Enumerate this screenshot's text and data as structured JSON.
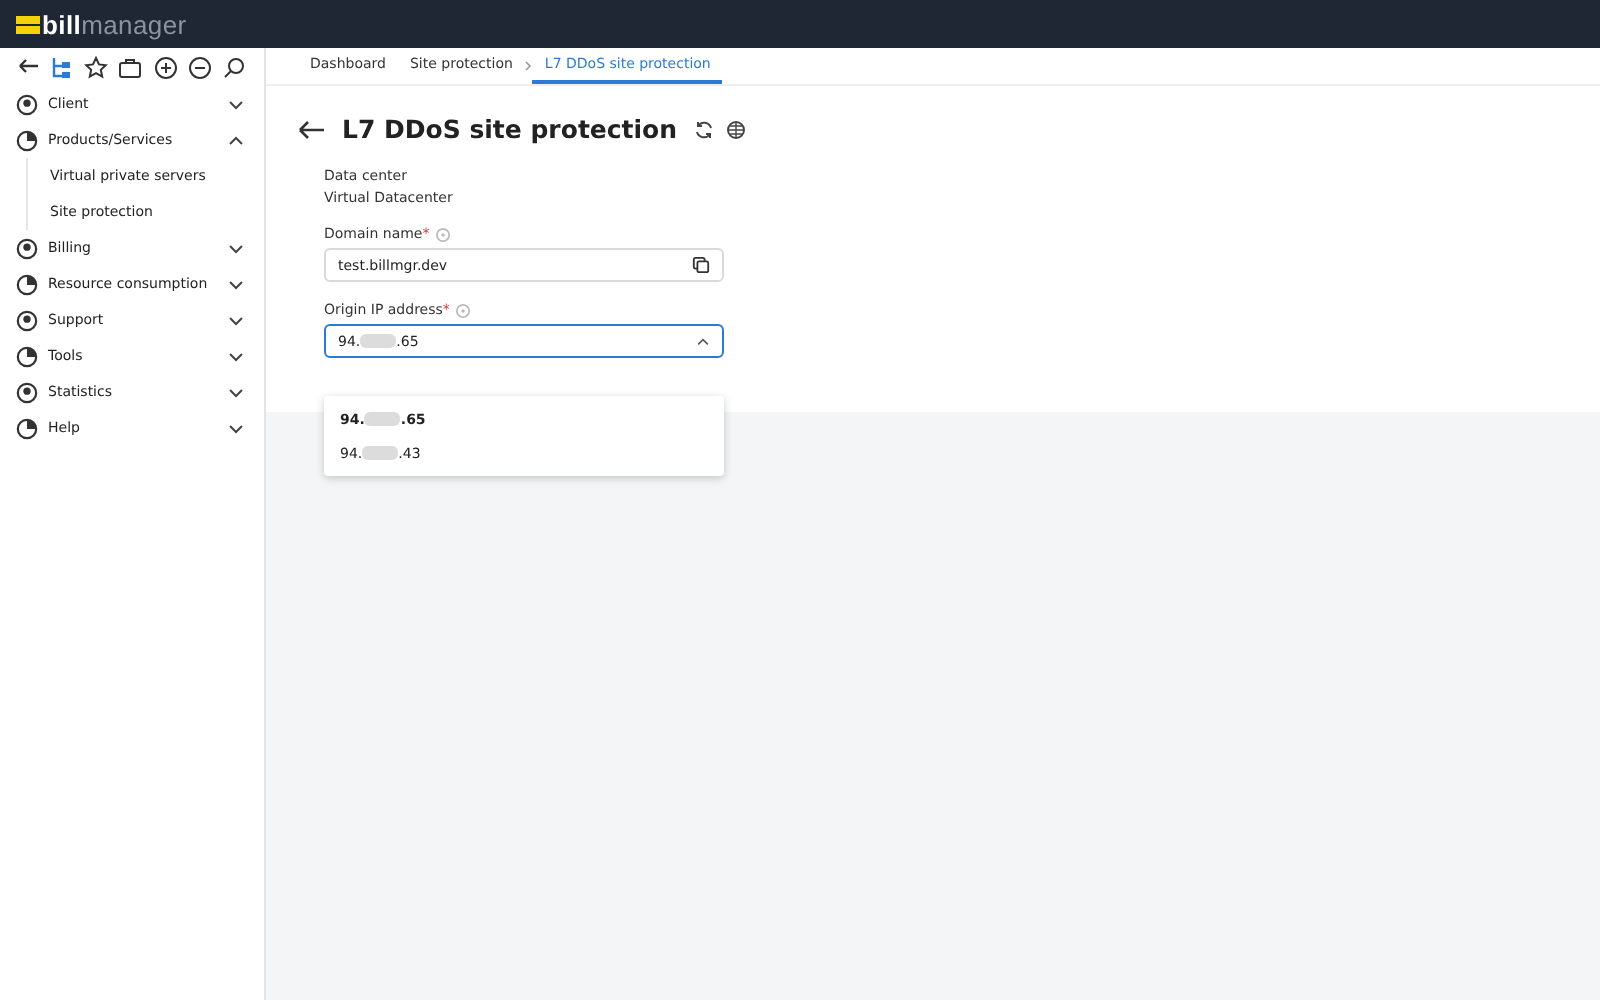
{
  "logo": {
    "part1": "bill",
    "part2": "manager"
  },
  "sidebar": {
    "items": [
      {
        "label": "Client",
        "expanded": false
      },
      {
        "label": "Products/Services",
        "expanded": true,
        "children": [
          {
            "label": "Virtual private servers"
          },
          {
            "label": "Site protection"
          }
        ]
      },
      {
        "label": "Billing",
        "expanded": false
      },
      {
        "label": "Resource consumption",
        "expanded": false
      },
      {
        "label": "Support",
        "expanded": false
      },
      {
        "label": "Tools",
        "expanded": false
      },
      {
        "label": "Statistics",
        "expanded": false
      },
      {
        "label": "Help",
        "expanded": false
      }
    ]
  },
  "tabs": [
    {
      "label": "Dashboard",
      "selected": false
    },
    {
      "label": "Site protection",
      "selected": false
    },
    {
      "label": "L7 DDoS site protection",
      "selected": true
    }
  ],
  "page": {
    "title": "L7 DDoS site protection"
  },
  "form": {
    "data_center": {
      "label": "Data center",
      "value": "Virtual Datacenter"
    },
    "domain": {
      "label": "Domain name",
      "required_mark": "*",
      "value": "test.billmgr.dev"
    },
    "origin_ip": {
      "label": "Origin IP address",
      "required_mark": "*",
      "expanded": true,
      "value": {
        "prefix": "94.",
        "suffix": ".65"
      },
      "options": [
        {
          "prefix": "94.",
          "suffix": ".65",
          "selected": true
        },
        {
          "prefix": "94.",
          "suffix": ".43",
          "selected": false
        }
      ]
    }
  }
}
